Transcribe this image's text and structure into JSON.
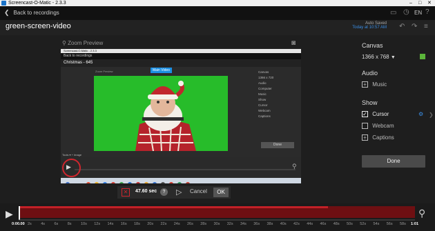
{
  "window": {
    "title": "Screencast-O-Matic - 2.3.3",
    "controls": [
      "–",
      "□",
      "✕"
    ]
  },
  "header": {
    "back_label": "Back to recordings",
    "language": "EN",
    "project_name": "green-screen-video",
    "autosave_line1": "Auto Saved",
    "autosave_line2": "Today at 10:57 AM"
  },
  "preview": {
    "zoom_label": "Zoom Preview",
    "inner": {
      "window_title": "Screencast-O-Matic - 2.3.3",
      "back_label": "Back to recordings",
      "project_name": "Christmas - 645",
      "zoom_label": "Zoom Preview",
      "badge": "Main Video",
      "canvas_label": "Canvas",
      "canvas_value": "1366 x 720",
      "audio_label": "Audio",
      "computer": "Computer",
      "music": "Music",
      "show_label": "Show",
      "cursor": "Cursor",
      "webcam": "Webcam",
      "captions": "Captions",
      "done": "Done",
      "tools": "Tools ▾   + Image"
    }
  },
  "right_panel": {
    "canvas_label": "Canvas",
    "canvas_value": "1366 x 768",
    "audio_label": "Audio",
    "music_label": "Music",
    "show_label": "Show",
    "cursor_label": "Cursor",
    "webcam_label": "Webcam",
    "captions_label": "Captions",
    "done_label": "Done",
    "canvas_color": "#5bb53a"
  },
  "cut_bar": {
    "duration": "47.60 sec",
    "help": "?",
    "cancel_label": "Cancel",
    "ok_label": "OK"
  },
  "timeline": {
    "current_time": "0:00.00",
    "end_time": "1:01",
    "ticks": [
      "2s",
      "4s",
      "6s",
      "8s",
      "10s",
      "12s",
      "14s",
      "16s",
      "18s",
      "20s",
      "22s",
      "24s",
      "26s",
      "28s",
      "30s",
      "32s",
      "34s",
      "36s",
      "38s",
      "40s",
      "42s",
      "44s",
      "46s",
      "48s",
      "50s",
      "52s",
      "54s",
      "56s",
      "58s"
    ],
    "selected_fraction": 0.78
  },
  "colors": {
    "accent": "#1a8fe3",
    "selection": "#c32027",
    "green_screen": "#27bc2a"
  }
}
